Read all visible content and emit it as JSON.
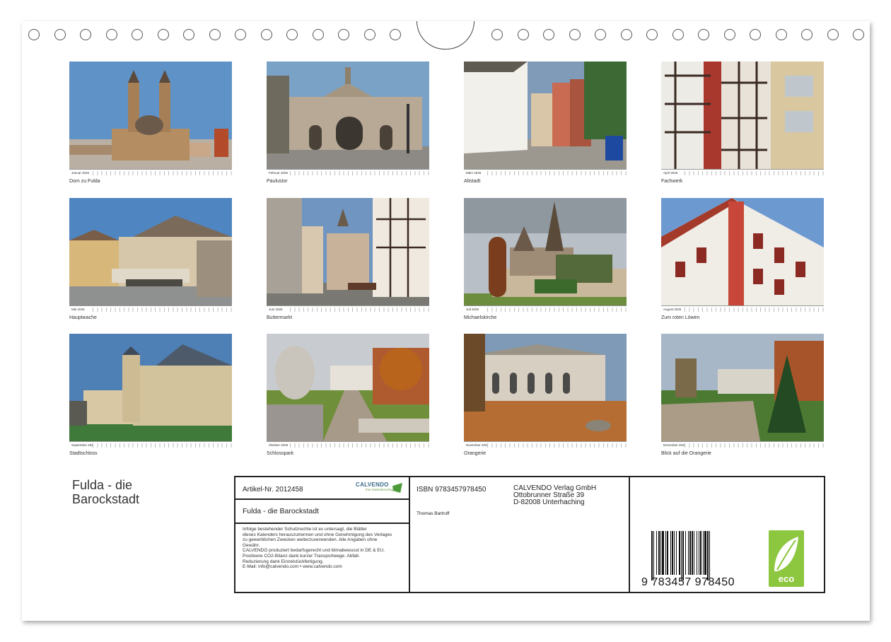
{
  "calendar_title": "Fulda - die Barockstadt",
  "title_lines": [
    "Fulda - die",
    "Barockstadt"
  ],
  "months": [
    {
      "month": "Januar 2026",
      "caption": "Dom zu Fulda"
    },
    {
      "month": "Februar 2026",
      "caption": "Paulustor"
    },
    {
      "month": "März 2026",
      "caption": "Altstadt"
    },
    {
      "month": "April 2026",
      "caption": "Fachwerk"
    },
    {
      "month": "Mai 2026",
      "caption": "Hauptwache"
    },
    {
      "month": "Juni 2026",
      "caption": "Buttermarkt"
    },
    {
      "month": "Juli 2026",
      "caption": "Michaelskirche"
    },
    {
      "month": "August 2026",
      "caption": "Zum roten Löwen"
    },
    {
      "month": "September 2026",
      "caption": "Stadtschloss"
    },
    {
      "month": "Oktober 2026",
      "caption": "Schlosspark"
    },
    {
      "month": "November 2026",
      "caption": "Orangerie"
    },
    {
      "month": "Dezember 2026",
      "caption": "Blick auf die Orangerie"
    }
  ],
  "info": {
    "article": "Artikel-Nr. 2012458",
    "logo_name": "CALVENDO",
    "logo_tagline": "Ihre Kalenderverlag",
    "title": "Fulda - die Barockstadt",
    "legal_lines": [
      "Infolge bestehender Schutzrechte ist es untersagt, die Blätter",
      "dieses Kalenders herauszutrennen und ohne Genehmigung des Verlages",
      "zu gewerblichen Zwecken weiterzuverwenden. Alle Angaben ohne",
      "Gewähr.",
      "CALVENDO produziert bedarfsgerecht und klimabewusst in DE & EU.",
      "Positivere CO2-Bilanz dank kurzer Transportwege. Abfall-",
      "Reduzierung dank Einzelstückfertigung.",
      "E-Mail: info@calvendo.com • www.calvendo.com"
    ],
    "isbn": "ISBN 9783457978450",
    "author": "Thomas Bartruff",
    "publisher_lines": [
      "CALVENDO Verlag GmbH",
      "Ottobrunner Straße 39",
      "D-82008 Unterhaching"
    ],
    "barcode_number": "9 783457 978450",
    "eco_label": "eco"
  }
}
